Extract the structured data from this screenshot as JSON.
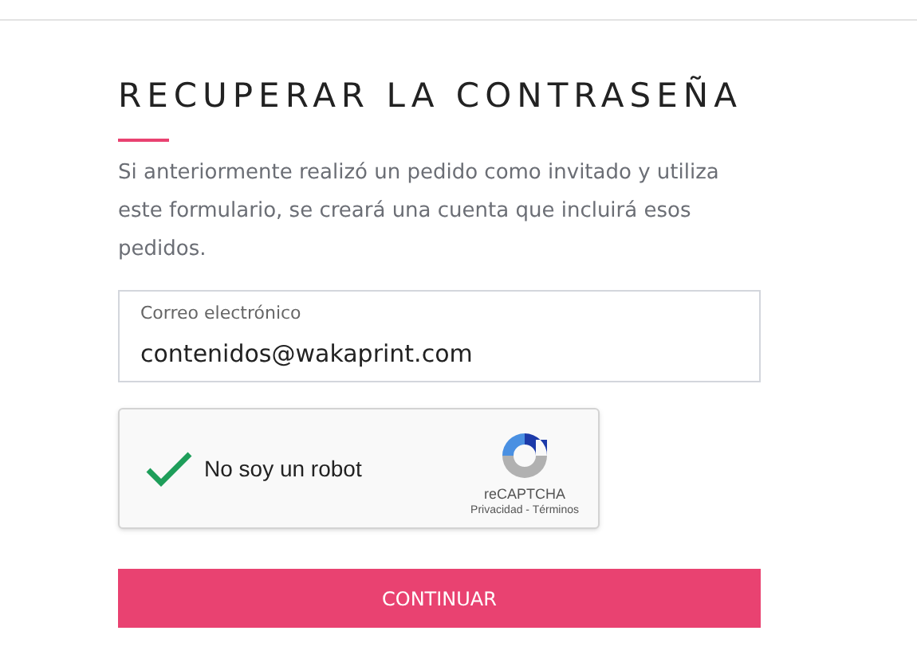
{
  "title": "RECUPERAR LA CONTRASEÑA",
  "description": "Si anteriormente realizó un pedido como invitado y utiliza este formulario, se creará una cuenta que incluirá esos pedidos.",
  "email_field": {
    "label": "Correo electrónico",
    "value": "contenidos@wakaprint.com"
  },
  "captcha": {
    "label": "No soy un robot",
    "checked": true,
    "brand": "reCAPTCHA",
    "links": "Privacidad - Términos"
  },
  "submit_button": "CONTINUAR"
}
